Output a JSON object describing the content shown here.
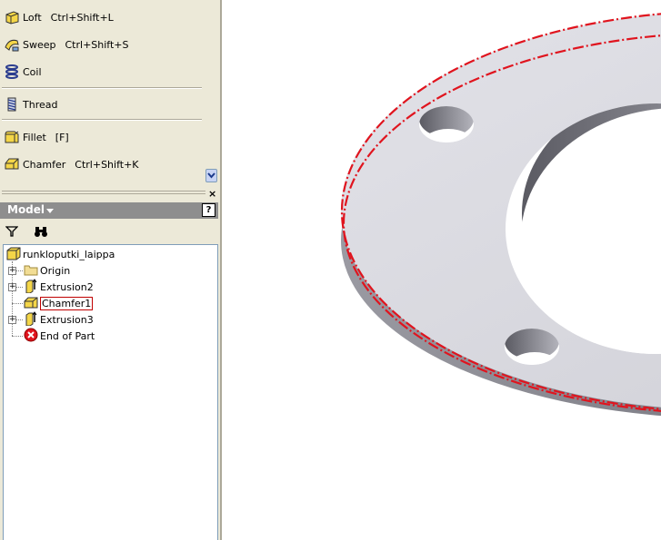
{
  "panel_bar": {
    "tools": [
      {
        "label": "Loft",
        "shortcut": "Ctrl+Shift+L",
        "icon": "loft-icon"
      },
      {
        "label": "Sweep",
        "shortcut": "Ctrl+Shift+S",
        "icon": "sweep-icon"
      },
      {
        "label": "Coil",
        "shortcut": "",
        "icon": "coil-icon"
      },
      {
        "label": "Thread",
        "shortcut": "",
        "icon": "thread-icon"
      },
      {
        "label": "Fillet",
        "shortcut": "[F]",
        "icon": "fillet-icon"
      },
      {
        "label": "Chamfer",
        "shortcut": "Ctrl+Shift+K",
        "icon": "chamfer-icon"
      }
    ],
    "close_label": "×"
  },
  "browser": {
    "title": "Model",
    "help_label": "?",
    "tree": {
      "root": "runkloputki_laippa",
      "items": [
        {
          "label": "Origin",
          "icon": "folder-icon"
        },
        {
          "label": "Extrusion2",
          "icon": "extrusion-icon"
        },
        {
          "label": "Chamfer1",
          "icon": "chamfer-icon",
          "selected": true
        },
        {
          "label": "Extrusion3",
          "icon": "extrusion-icon"
        },
        {
          "label": "End of Part",
          "icon": "end-of-part-icon"
        }
      ]
    }
  },
  "colors": {
    "selection_highlight": "#e0141e",
    "panel_background": "#ece9d8",
    "browser_header": "#8e8e8e"
  }
}
